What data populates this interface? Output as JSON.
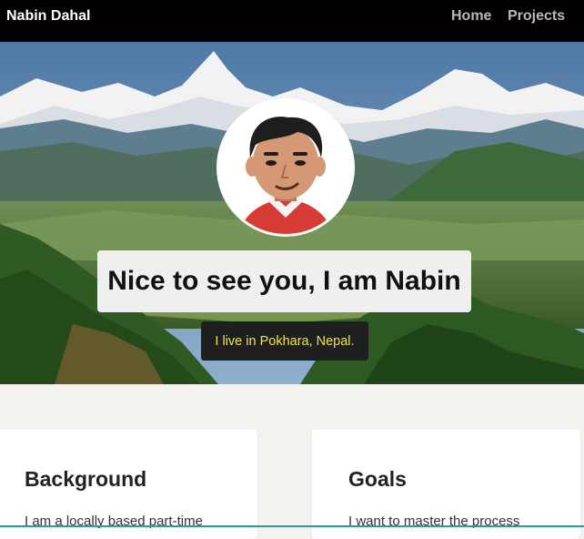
{
  "navbar": {
    "brand": "Nabin Dahal",
    "links": [
      "Home",
      "Projects"
    ]
  },
  "hero": {
    "headline": "Nice to see you, I am Nabin",
    "subline": "I live in Pokhara, Nepal."
  },
  "cards": [
    {
      "title": "Background",
      "text": "I am a locally based part-time"
    },
    {
      "title": "Goals",
      "text": "I want to master the process"
    }
  ],
  "colors": {
    "navbar_bg": "#000000",
    "nav_link": "#b8b8b8",
    "headline_bg": "#efefef",
    "subline_bg": "#1f1f1f",
    "subline_text": "#f2e34a",
    "page_bg": "#f4f2ee"
  },
  "icons": {
    "avatar": "cartoon-avatar"
  }
}
